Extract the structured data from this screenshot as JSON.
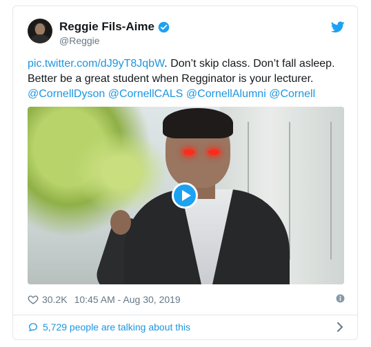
{
  "user": {
    "display_name": "Reggie Fils-Aime",
    "handle": "@Reggie"
  },
  "tweet": {
    "link": "pic.twitter.com/dJ9yT8JqbW",
    "text_line1": ". Don’t skip class. Don’t fall asleep.",
    "text_line2": "Better be a great student when Regginator is your lecturer.",
    "mentions": [
      "@CornellDyson",
      "@CornellCALS",
      "@CornellAlumni",
      "@Cornell"
    ]
  },
  "meta": {
    "likes": "30.2K",
    "timestamp": "10:45 AM - Aug 30, 2019"
  },
  "footer": {
    "talking_text": "5,729 people are talking about this"
  },
  "colors": {
    "accent": "#1da1f2",
    "link": "#1b95e0",
    "secondary_text": "#657786",
    "border": "#e1e8ed"
  },
  "icons": [
    "verified-icon",
    "twitter-logo-icon",
    "play-icon",
    "heart-icon",
    "info-icon",
    "speech-bubble-icon",
    "chevron-right-icon"
  ]
}
